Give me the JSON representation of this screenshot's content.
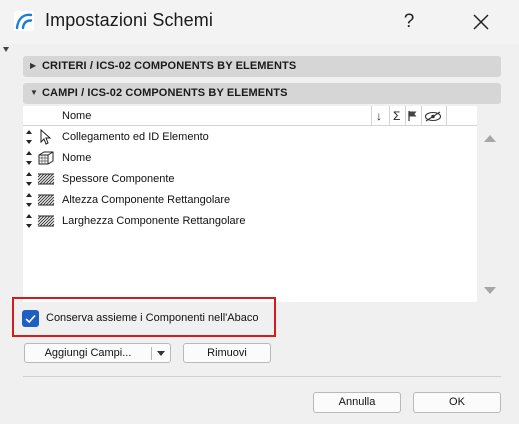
{
  "window": {
    "title": "Impostazioni Schemi",
    "help_label": "?",
    "app_icon": "archicad-arc-icon"
  },
  "sections": {
    "criteri": {
      "label": "CRITERI / ICS-02 COMPONENTS BY ELEMENTS",
      "expanded": false
    },
    "campi": {
      "label": "CAMPI / ICS-02 COMPONENTS BY ELEMENTS",
      "expanded": true
    }
  },
  "fields_table": {
    "header": {
      "name_label": "Nome",
      "column_icons": [
        "sort-down-arrow-icon",
        "sum-sigma-icon",
        "flag-icon",
        "hide-eye-icon"
      ]
    },
    "rows": [
      {
        "label": "Collegamento ed ID Elemento",
        "icon": "cursor-arrow-icon"
      },
      {
        "label": "Nome",
        "icon": "component-block-icon"
      },
      {
        "label": "Spessore Componente",
        "icon": "hatch-pattern-icon"
      },
      {
        "label": "Altezza Componente Rettangolare",
        "icon": "hatch-pattern-icon"
      },
      {
        "label": "Larghezza Componente Rettangolare",
        "icon": "hatch-pattern-icon"
      }
    ]
  },
  "options": {
    "keep_components_together": {
      "label": "Conserva assieme i Componenti nell'Abaco",
      "checked": true
    }
  },
  "buttons": {
    "add_fields": "Aggiungi Campi...",
    "remove": "Rimuovi",
    "cancel": "Annulla",
    "ok": "OK"
  },
  "colors": {
    "highlight_box": "#d31d1d",
    "checkbox_accent": "#1f5fc2",
    "section_bar": "#d6d6d6"
  }
}
